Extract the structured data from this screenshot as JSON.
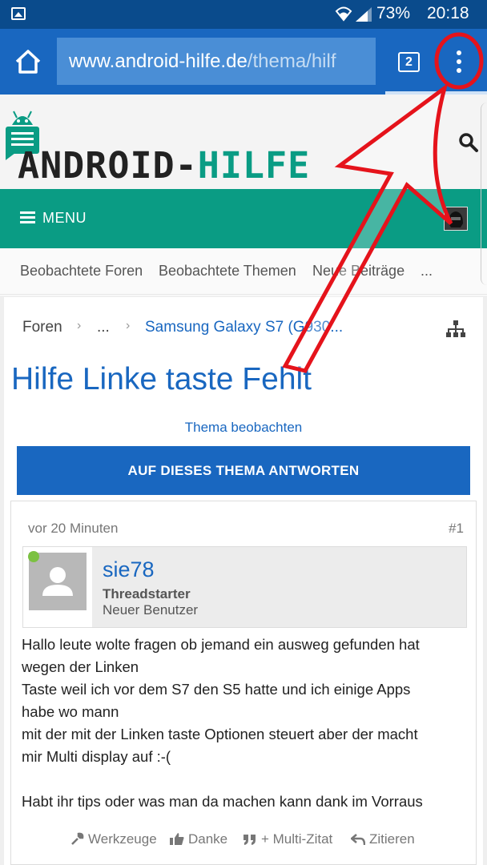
{
  "status_bar": {
    "battery": "73%",
    "time": "20:18"
  },
  "browser": {
    "url_host": "www.android-hilfe.de",
    "url_path": "/thema/hilf",
    "tab_count": "2"
  },
  "site": {
    "logo_main": "ANDROID-",
    "logo_accent": "HILFE",
    "menu_label": "MENU",
    "subnav": [
      "Beobachtete Foren",
      "Beobachtete Themen",
      "Neue Beiträge",
      "..."
    ]
  },
  "breadcrumb": [
    "Foren",
    "...",
    "Samsung Galaxy S7 (G930..."
  ],
  "thread": {
    "title": "Hilfe Linke taste Fehlt",
    "watch_label": "Thema beobachten",
    "reply_label": "AUF DIESES THEMA ANTWORTEN"
  },
  "post": {
    "time": "vor 20 Minuten",
    "number": "#1",
    "username": "sie78",
    "role": "Threadstarter",
    "rank": "Neuer Benutzer",
    "lines": [
      "Hallo leute wolte fragen ob jemand ein ausweg gefunden hat",
      "wegen der Linken",
      "Taste weil ich vor dem S7 den S5 hatte und ich einige Apps",
      "habe wo mann",
      "mit der mit der Linken taste Optionen steuert aber der macht",
      "mir Multi display auf :-(",
      "",
      "Habt ihr tips oder was man da machen kann dank im Vorraus"
    ],
    "actions": [
      "Werkzeuge",
      "Danke",
      "+ Multi-Zitat",
      "Zitieren"
    ]
  },
  "colors": {
    "status_bar": "#0a4b8c",
    "browser_bar": "#1967c0",
    "accent_teal": "#0a9c84",
    "link_blue": "#1967c0",
    "annotation_red": "#e5131b"
  }
}
